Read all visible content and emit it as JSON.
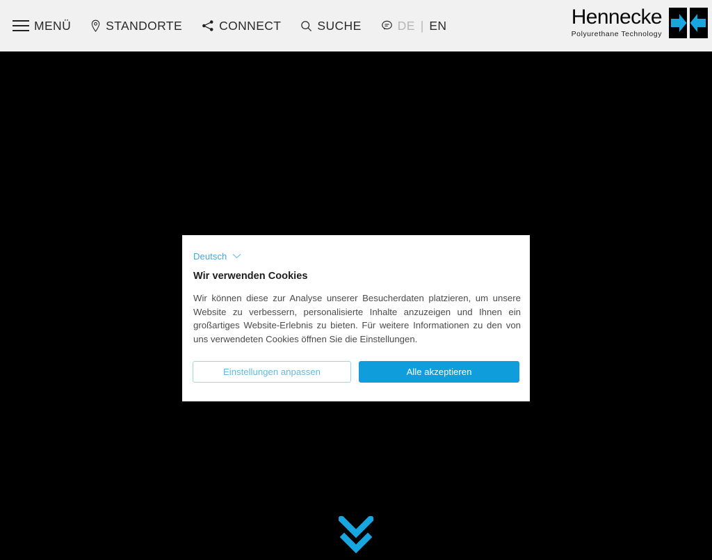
{
  "header": {
    "nav": [
      {
        "label": "MENÜ",
        "icon": "hamburger-menu-icon"
      },
      {
        "label": "STANDORTE",
        "icon": "map-pin-icon"
      },
      {
        "label": "CONNECT",
        "icon": "share-icon"
      },
      {
        "label": "SUCHE",
        "icon": "search-icon"
      }
    ],
    "language": {
      "icon": "speech-bubble-icon",
      "current": "DE",
      "separator": "|",
      "alternate": "EN"
    },
    "logo": {
      "wordmark": "Hennecke",
      "tagline": "Polyurethane Technology",
      "mark_icon": "hennecke-converging-arrows-icon"
    }
  },
  "cookie_dialog": {
    "language_selector": {
      "label": "Deutsch",
      "chevron_icon": "chevron-down-icon"
    },
    "title": "Wir verwenden Cookies",
    "body": "Wir können diese zur Analyse unserer Besucherdaten platzieren, um unsere Website zu verbessern, personalisierte Inhalte anzuzeigen und Ihnen ein großartiges Website-Erlebnis zu bieten. Für weitere Informationen zu den von uns verwendeten Cookies öffnen Sie die Einstellungen.",
    "buttons": {
      "customize": "Einstellungen anpassen",
      "accept_all": "Alle akzeptieren"
    }
  },
  "hero": {
    "scroll_indicator_icon": "double-chevron-down-icon"
  },
  "colors": {
    "brand_blue": "#0f9edb",
    "link_blue": "#3fa8de",
    "outline_blue": "#9ed3ec",
    "header_bg": "#f1f1f1",
    "hero_bg": "#000000",
    "dialog_bg": "#ffffff",
    "nav_text": "#2a2a2a",
    "lang_inactive": "#b6b6b6"
  }
}
